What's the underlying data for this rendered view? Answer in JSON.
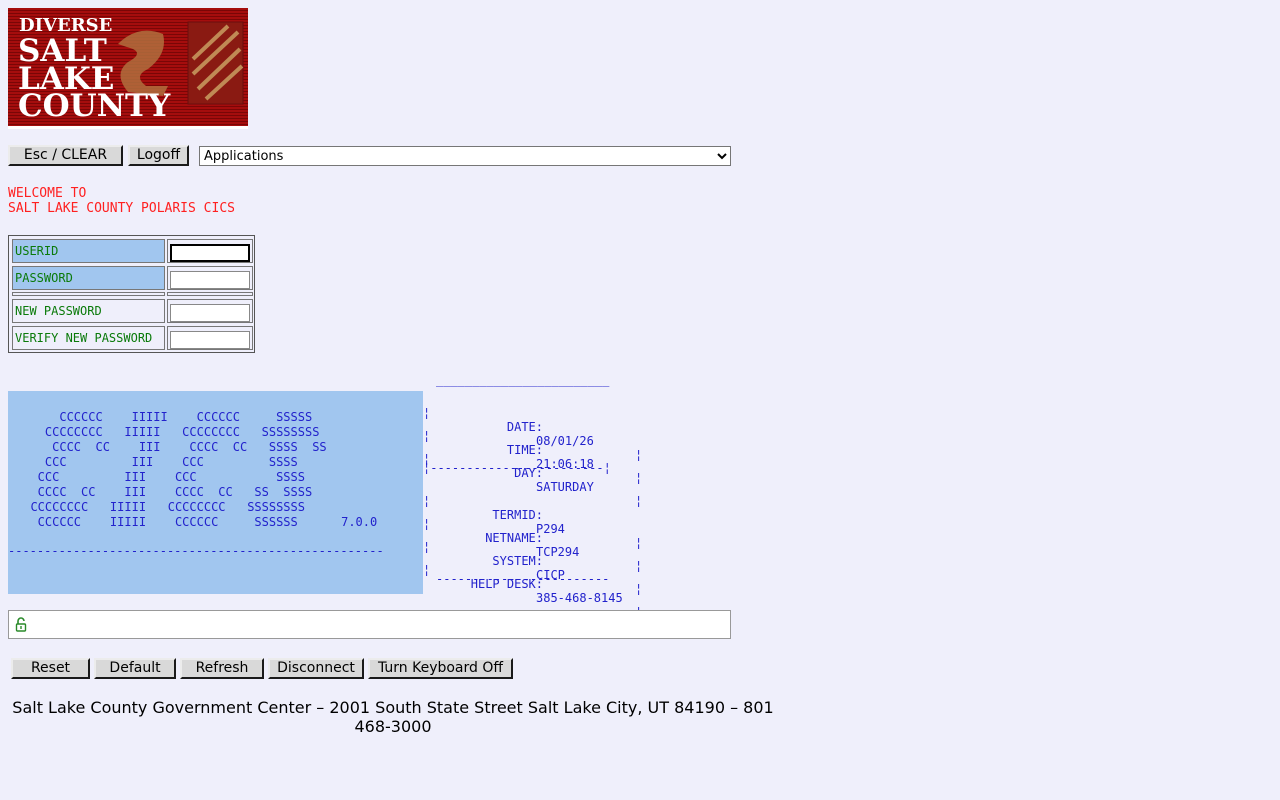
{
  "logo": {
    "line1": "DIVERSE",
    "line2": "SALT",
    "line3": "LAKE",
    "line4": "COUNTY"
  },
  "toolbar": {
    "esc_label": "Esc / CLEAR",
    "logoff_label": "Logoff",
    "app_select_value": "Applications"
  },
  "welcome": {
    "line1": "WELCOME TO",
    "line2": "SALT LAKE COUNTY POLARIS CICS"
  },
  "login": {
    "userid_label": "USERID",
    "password_label": "PASSWORD",
    "new_password_label": "NEW PASSWORD",
    "verify_password_label": "VERIFY NEW PASSWORD"
  },
  "banner": {
    "art": "      CCCCCC    IIIII    CCCCCC     SSSSS\n    CCCCCCCC   IIIII   CCCCCCCC   SSSSSSSS\n     CCCC  CC    III    CCCC  CC   SSSS  SS\n    CCC         III    CCC         SSSS\n   CCC         III    CCC           SSSS\n   CCCC  CC    III    CCCC  CC   SS  SSSS\n  CCCCCCCC   IIIII   CCCCCCCC   SSSSSSSS\n   CCCCCC    IIIII    CCCCCC     SSSSSS      7.0.0",
    "dash": "----------------------------------------------------"
  },
  "info": {
    "top_rule": "________________________",
    "date_label": "DATE:",
    "date_value": "08/01/26",
    "time_label": "TIME:",
    "time_value": "21:06:18",
    "day_label": "DAY:",
    "day_value": "SATURDAY",
    "mid_rule": "¦------------------------¦",
    "termid_label": "TERMID:",
    "termid_value": "P294",
    "netname_label": "NETNAME:",
    "netname_value": "TCP294",
    "system_label": "SYSTEM:",
    "system_value": "CICP",
    "helpdesk_label": "HELP DESK:",
    "helpdesk_value": "385-468-8145",
    "bottom_rule": "------------------------",
    "bar_char": "¦"
  },
  "buttons": {
    "reset": "Reset",
    "default": "Default",
    "refresh": "Refresh",
    "disconnect": "Disconnect",
    "keyboard": "Turn Keyboard Off"
  },
  "footer": {
    "text": "Salt Lake County Government Center – 2001 South State Street Salt Lake City, UT 84190 – 801 468-3000"
  },
  "colors": {
    "background": "#efeffb",
    "banner": "#a1c6ef",
    "welcome_text": "#ff2020",
    "label_text": "#0a7a0a",
    "terminal_text": "#2222cc"
  }
}
